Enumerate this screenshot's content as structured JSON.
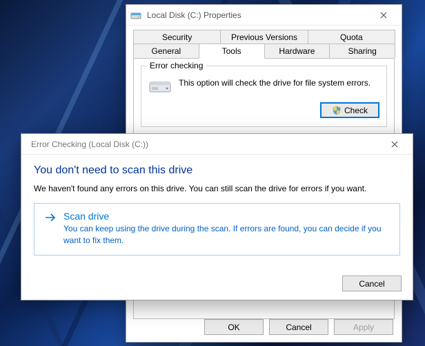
{
  "properties": {
    "title": "Local Disk (C:) Properties",
    "tabs_row1": [
      "Security",
      "Previous Versions",
      "Quota"
    ],
    "tabs_row2": [
      "General",
      "Tools",
      "Hardware",
      "Sharing"
    ],
    "active_tab": "Tools",
    "error_checking": {
      "legend": "Error checking",
      "text": "This option will check the drive for file system errors.",
      "button": "Check"
    },
    "buttons": {
      "ok": "OK",
      "cancel": "Cancel",
      "apply": "Apply"
    }
  },
  "error_dialog": {
    "title": "Error Checking (Local Disk (C:))",
    "headline": "You don't need to scan this drive",
    "subtext": "We haven't found any errors on this drive. You can still scan the drive for errors if you want.",
    "option": {
      "title": "Scan drive",
      "desc": "You can keep using the drive during the scan. If errors are found, you can decide if you want to fix them."
    },
    "cancel": "Cancel"
  }
}
